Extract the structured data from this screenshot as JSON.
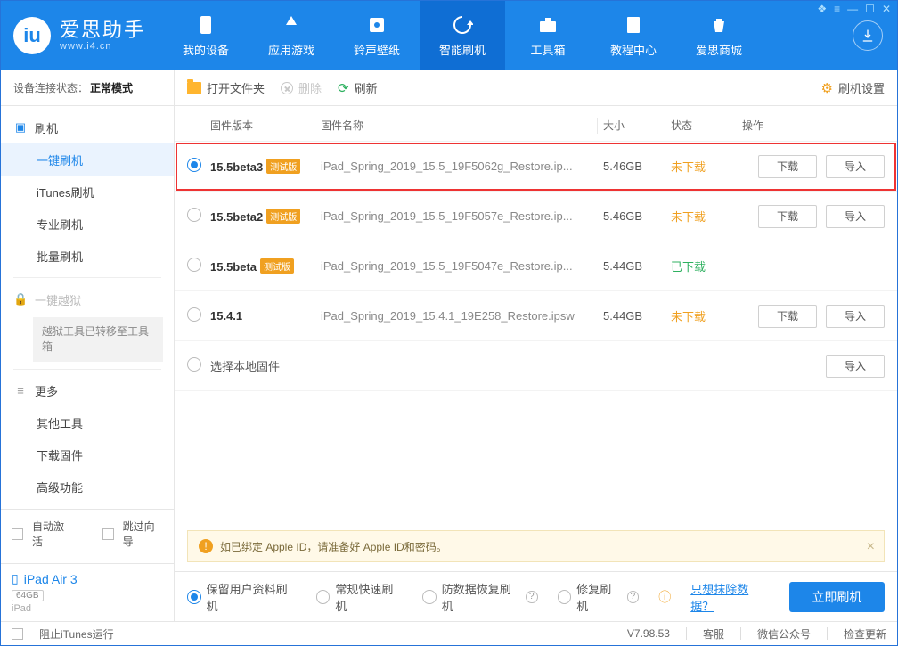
{
  "titlebar_glyphs": [
    "❖",
    "≡",
    "—",
    "☐",
    "✕"
  ],
  "logo": {
    "title": "爱思助手",
    "sub": "www.i4.cn"
  },
  "nav": [
    {
      "label": "我的设备"
    },
    {
      "label": "应用游戏"
    },
    {
      "label": "铃声壁纸"
    },
    {
      "label": "智能刷机",
      "active": true
    },
    {
      "label": "工具箱"
    },
    {
      "label": "教程中心"
    },
    {
      "label": "爱思商城"
    }
  ],
  "toolbar": {
    "open": "打开文件夹",
    "delete": "删除",
    "refresh": "刷新",
    "settings": "刷机设置"
  },
  "sidebar": {
    "conn_label": "设备连接状态：",
    "conn_value": "正常模式",
    "group_flash": "刷机",
    "items_flash": [
      "一键刷机",
      "iTunes刷机",
      "专业刷机",
      "批量刷机"
    ],
    "group_jailbreak": "一键越狱",
    "jailbreak_note": "越狱工具已转移至工具箱",
    "group_more": "更多",
    "items_more": [
      "其他工具",
      "下载固件",
      "高级功能"
    ],
    "auto_activate": "自动激活",
    "skip_guide": "跳过向导",
    "device": {
      "name": "iPad Air 3",
      "storage": "64GB",
      "model": "iPad"
    }
  },
  "table": {
    "headers": {
      "version": "固件版本",
      "name": "固件名称",
      "size": "大小",
      "status": "状态",
      "ops": "操作"
    },
    "rows": [
      {
        "sel": true,
        "ver": "15.5beta3",
        "beta": true,
        "name": "iPad_Spring_2019_15.5_19F5062g_Restore.ip...",
        "size": "5.46GB",
        "status": "未下载",
        "status_cls": "no",
        "dl": true,
        "imp": true,
        "highlight": true
      },
      {
        "sel": false,
        "ver": "15.5beta2",
        "beta": true,
        "name": "iPad_Spring_2019_15.5_19F5057e_Restore.ip...",
        "size": "5.46GB",
        "status": "未下载",
        "status_cls": "no",
        "dl": true,
        "imp": true
      },
      {
        "sel": false,
        "ver": "15.5beta",
        "beta": true,
        "name": "iPad_Spring_2019_15.5_19F5047e_Restore.ip...",
        "size": "5.44GB",
        "status": "已下载",
        "status_cls": "ok",
        "dl": false,
        "imp": false
      },
      {
        "sel": false,
        "ver": "15.4.1",
        "beta": false,
        "name": "iPad_Spring_2019_15.4.1_19E258_Restore.ipsw",
        "size": "5.44GB",
        "status": "未下载",
        "status_cls": "no",
        "dl": true,
        "imp": true
      },
      {
        "sel": false,
        "ver": "选择本地固件",
        "beta": false,
        "name": "",
        "size": "",
        "status": "",
        "status_cls": "",
        "dl": false,
        "imp": true,
        "local": true
      }
    ],
    "beta_tag": "测试版",
    "btn_dl": "下载",
    "btn_imp": "导入"
  },
  "notice": "如已绑定 Apple ID，请准备好 Apple ID和密码。",
  "options": {
    "o1": "保留用户资料刷机",
    "o2": "常规快速刷机",
    "o3": "防数据恢复刷机",
    "o4": "修复刷机",
    "link": "只想抹除数据？",
    "go": "立即刷机"
  },
  "statusbar": {
    "block": "阻止iTunes运行",
    "ver": "V7.98.53",
    "s1": "客服",
    "s2": "微信公众号",
    "s3": "检查更新"
  }
}
